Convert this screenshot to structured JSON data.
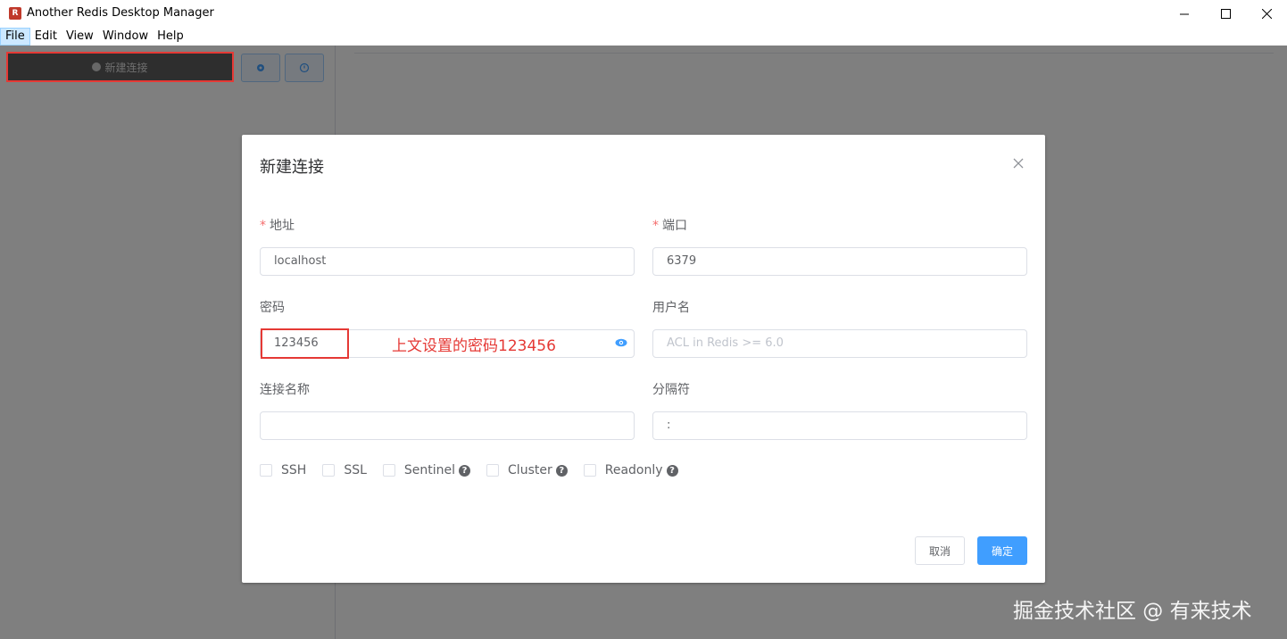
{
  "window": {
    "title": "Another Redis Desktop Manager",
    "logo_icon": "redis-logo-icon"
  },
  "menu": [
    "File",
    "Edit",
    "View",
    "Window",
    "Help"
  ],
  "sidebar": {
    "new_connection_label": "新建连接"
  },
  "dialog": {
    "title": "新建连接",
    "fields": {
      "host_label": "地址",
      "host_value": "localhost",
      "port_label": "端口",
      "port_value": "6379",
      "password_label": "密码",
      "password_value": "123456",
      "username_label": "用户名",
      "username_placeholder": "ACL in Redis >= 6.0",
      "name_label": "连接名称",
      "name_value": "",
      "separator_label": "分隔符",
      "separator_value": ":"
    },
    "options": [
      "SSH",
      "SSL",
      "Sentinel",
      "Cluster",
      "Readonly"
    ],
    "cancel_label": "取消",
    "ok_label": "确定"
  },
  "annotation": {
    "password_note": "上文设置的密码123456"
  },
  "watermark": "掘金技术社区 @ 有来技术",
  "colors": {
    "primary": "#409eff",
    "annotation": "#e53935",
    "required": "#f56c6c"
  }
}
